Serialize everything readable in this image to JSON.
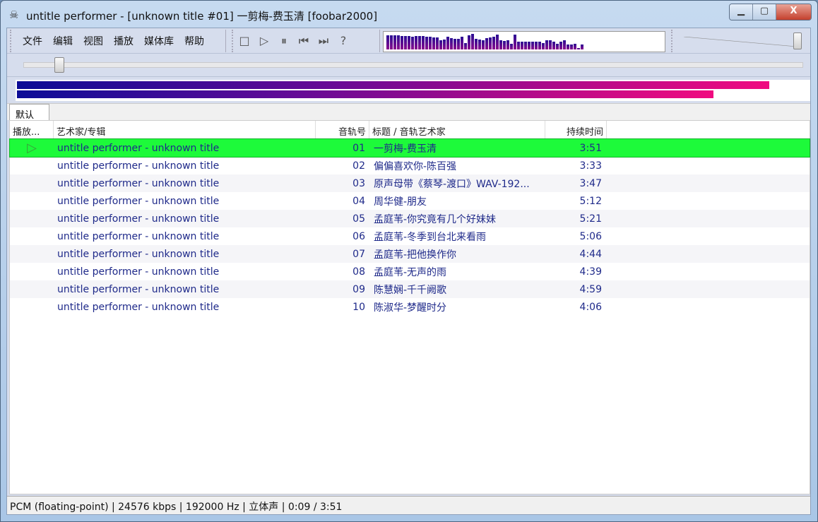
{
  "window": {
    "title": "untitle performer - [unknown title #01] 一剪梅-费玉清  [foobar2000]",
    "minimize": "▁",
    "maximize": "▢",
    "close": "X"
  },
  "menu": [
    "文件",
    "编辑",
    "视图",
    "播放",
    "媒体库",
    "帮助"
  ],
  "transport": {
    "stop": "□",
    "play": "▷",
    "pause": "⏸",
    "prev": "⏮",
    "next": "⏭",
    "random": "?"
  },
  "spectrum_levels": [
    0.9,
    0.9,
    0.9,
    0.9,
    0.88,
    0.86,
    0.86,
    0.84,
    0.86,
    0.86,
    0.86,
    0.84,
    0.8,
    0.78,
    0.78,
    0.6,
    0.64,
    0.8,
    0.72,
    0.66,
    0.66,
    0.8,
    0.4,
    0.9,
    1.0,
    0.7,
    0.62,
    0.6,
    0.72,
    0.76,
    0.8,
    0.95,
    0.6,
    0.56,
    0.6,
    0.38,
    0.95,
    0.52,
    0.52,
    0.52,
    0.52,
    0.48,
    0.5,
    0.5,
    0.4,
    0.6,
    0.6,
    0.5,
    0.38,
    0.5,
    0.6,
    0.3,
    0.3,
    0.38,
    0.08,
    0.3
  ],
  "volume_level": 0.97,
  "seek_position": 0.04,
  "vu_levels": [
    0.95,
    0.88
  ],
  "tabs": [
    {
      "label": "默认"
    }
  ],
  "columns": [
    "播放...",
    "艺术家/专辑",
    "音轨号",
    "标题 / 音轨艺术家",
    "持续时间"
  ],
  "tracks": [
    {
      "playing": "▷",
      "artist": "untitle performer - unknown title",
      "no": "01",
      "title": "一剪梅-费玉清",
      "dur": "3:51"
    },
    {
      "artist": "untitle performer - unknown title",
      "no": "02",
      "title": "偏偏喜欢你-陈百强",
      "dur": "3:33"
    },
    {
      "artist": "untitle performer - unknown title",
      "no": "03",
      "title": "原声母带《蔡琴-渡口》WAV-192...",
      "dur": "3:47"
    },
    {
      "artist": "untitle performer - unknown title",
      "no": "04",
      "title": "周华健-朋友",
      "dur": "5:12"
    },
    {
      "artist": "untitle performer - unknown title",
      "no": "05",
      "title": "孟庭苇-你究竟有几个好妹妹",
      "dur": "5:21"
    },
    {
      "artist": "untitle performer - unknown title",
      "no": "06",
      "title": "孟庭苇-冬季到台北来看雨",
      "dur": "5:06"
    },
    {
      "artist": "untitle performer - unknown title",
      "no": "07",
      "title": "孟庭苇-把他换作你",
      "dur": "4:44"
    },
    {
      "artist": "untitle performer - unknown title",
      "no": "08",
      "title": "孟庭苇-无声的雨",
      "dur": "4:39"
    },
    {
      "artist": "untitle performer - unknown title",
      "no": "09",
      "title": "陈慧娴-千千阙歌",
      "dur": "4:59"
    },
    {
      "artist": "untitle performer - unknown title",
      "no": "10",
      "title": "陈淑华-梦醒时分",
      "dur": "4:06"
    }
  ],
  "status": "PCM (floating-point) | 24576 kbps | 192000 Hz | 立体声 | 0:09 / 3:51"
}
